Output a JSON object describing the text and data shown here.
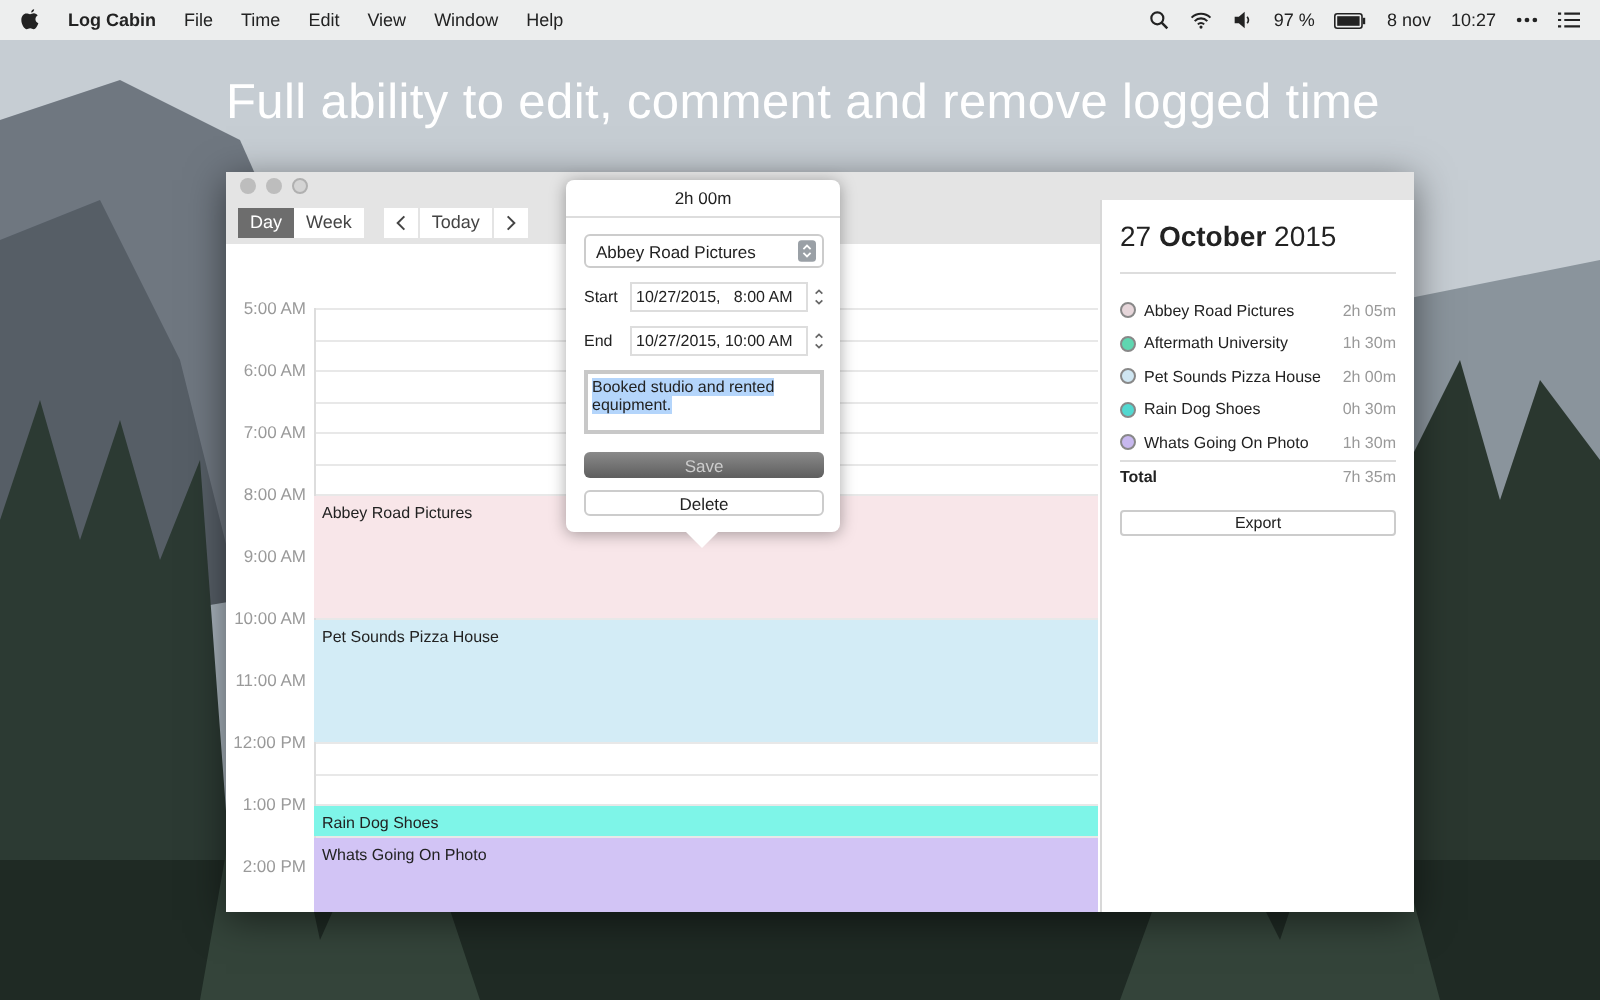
{
  "menu_bar": {
    "app_name": "Log Cabin",
    "menus": [
      "File",
      "Time",
      "Edit",
      "View",
      "Window",
      "Help"
    ],
    "battery": "97 %",
    "date": "8 nov",
    "time": "10:27"
  },
  "headline": "Full ability to edit, comment and remove logged time",
  "toolbar": {
    "views": [
      {
        "label": "Day",
        "selected": true
      },
      {
        "label": "Week",
        "selected": false
      }
    ],
    "today": "Today"
  },
  "calendar": {
    "hours": [
      "5:00 AM",
      "6:00 AM",
      "7:00 AM",
      "8:00 AM",
      "9:00 AM",
      "10:00 AM",
      "11:00 AM",
      "12:00 PM",
      "1:00 PM",
      "2:00 PM"
    ],
    "events": [
      {
        "title": "Abbey Road Pictures",
        "color": "#f8e6e9"
      },
      {
        "title": "Pet Sounds Pizza House",
        "color": "#d3ecf6"
      },
      {
        "title": "Rain Dog Shoes",
        "color": "#7ef5e8"
      },
      {
        "title": "Whats Going On Photo",
        "color": "#d2c4f5"
      }
    ]
  },
  "popover": {
    "duration": "2h 00m",
    "project": "Abbey Road Pictures",
    "start_label": "Start",
    "start": "10/27/2015,   8:00 AM",
    "end_label": "End",
    "end": "10/27/2015, 10:00 AM",
    "note": "Booked studio and rented equipment.",
    "save": "Save",
    "delete": "Delete"
  },
  "sidebar": {
    "date": "27 **October** 2015",
    "projects": [
      {
        "name": "Abbey Road Pictures",
        "time": "2h 05m",
        "color": "#e6d6da"
      },
      {
        "name": "Aftermath University",
        "time": "1h 30m",
        "color": "#5fd6b0"
      },
      {
        "name": "Pet Sounds Pizza House",
        "time": "2h 00m",
        "color": "#cfe6f2"
      },
      {
        "name": "Rain Dog Shoes",
        "time": "0h 30m",
        "color": "#52d8d0"
      },
      {
        "name": "Whats Going On Photo",
        "time": "1h 30m",
        "color": "#c7b8ee"
      }
    ],
    "total_label": "Total",
    "total": "7h 35m",
    "export": "Export"
  }
}
